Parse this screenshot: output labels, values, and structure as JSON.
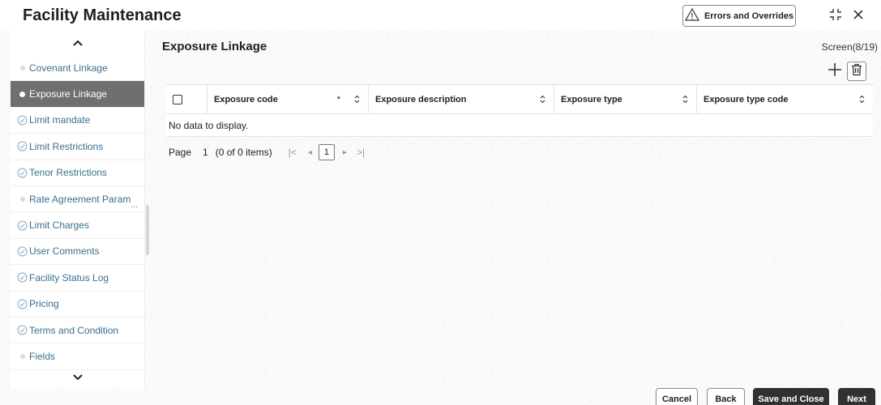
{
  "header": {
    "title": "Facility Maintenance",
    "errors_button": "Errors and Overrides",
    "icons": [
      "warning-icon",
      "minimize-icon",
      "close-icon"
    ]
  },
  "sidebar": {
    "items": [
      {
        "label": "Covenant Linkage",
        "state": "pending"
      },
      {
        "label": "Exposure Linkage",
        "state": "active"
      },
      {
        "label": "Limit mandate",
        "state": "visited"
      },
      {
        "label": "Limit Restrictions",
        "state": "visited"
      },
      {
        "label": "Tenor Restrictions",
        "state": "visited"
      },
      {
        "label": "Rate Agreement Param",
        "state": "pending"
      },
      {
        "label": "Limit Charges",
        "state": "visited"
      },
      {
        "label": "User Comments",
        "state": "visited"
      },
      {
        "label": "Facility Status Log",
        "state": "visited"
      },
      {
        "label": "Pricing",
        "state": "visited"
      },
      {
        "label": "Terms and Condition",
        "state": "visited"
      },
      {
        "label": "Fields",
        "state": "pending"
      }
    ],
    "overflow_marker": "..."
  },
  "main": {
    "title": "Exposure Linkage",
    "screen_counter": "Screen(8/19)",
    "grid": {
      "columns": [
        "Exposure code",
        "Exposure description",
        "Exposure type",
        "Exposure type code"
      ],
      "required_marker": "*",
      "empty_text": "No data to display."
    },
    "pager": {
      "page_label": "Page",
      "current_page": "1",
      "items_text": "(0 of 0 items)",
      "first": "|<",
      "prev": "◂",
      "next": "▸",
      "last": ">|"
    }
  },
  "footer": {
    "cancel": "Cancel",
    "back": "Back",
    "save_close": "Save and Close",
    "next": "Next"
  },
  "colors": {
    "active_bg": "#6f6f6f",
    "link": "#3a6e8f",
    "primary_button": "#313131"
  }
}
